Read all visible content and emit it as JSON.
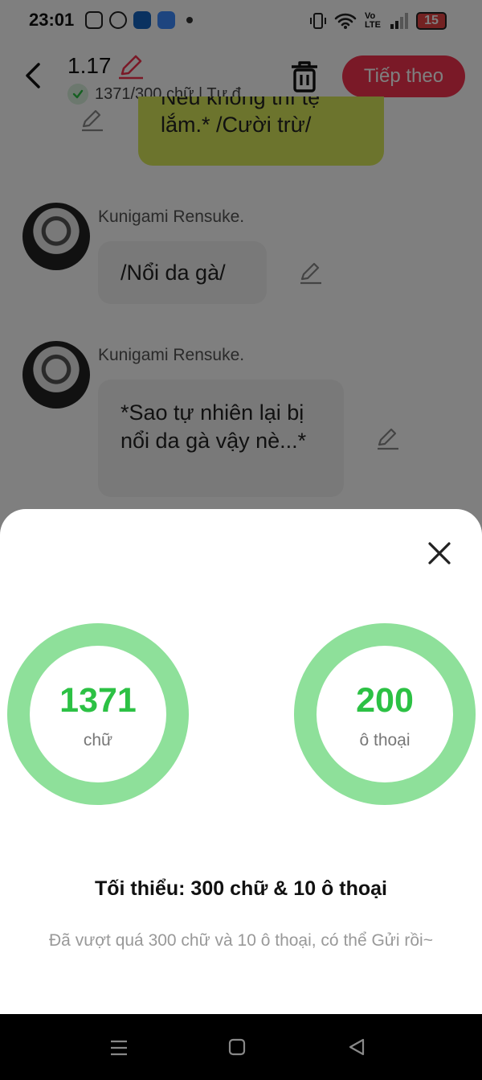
{
  "status_bar": {
    "time": "23:01",
    "network_label": "Vo LTE",
    "battery": "15",
    "app_icons": [
      "instagram-icon",
      "messenger-icon",
      "blue-app-icon",
      "blue-app-2-icon"
    ]
  },
  "header": {
    "title": "1.17",
    "subtitle": "1371/300 chữ | Tự đ",
    "next_label": "Tiếp theo"
  },
  "chat": {
    "partial_bubble_lines": [
      "Nếu không thì tệ",
      "lắm.* /Cười trừ/"
    ],
    "messages": [
      {
        "sender": "Kunigami Rensuke.",
        "text": "/Nổi da gà/"
      },
      {
        "sender": "Kunigami Rensuke.",
        "text": "*Sao tự nhiên lại bị nổi da gà vậy nè...*"
      }
    ]
  },
  "sheet": {
    "word_count": "1371",
    "word_unit": "chữ",
    "dialogue_count": "200",
    "dialogue_unit": "ô thoại",
    "title": "Tối thiểu: 300 chữ & 10 ô thoại",
    "description": "Đã vượt quá 300 chữ và 10 ô thoại, có thể Gửi rồi~"
  },
  "colors": {
    "accent": "#f5334e",
    "ring": "#8ee09a",
    "ring_text": "#2cc144",
    "green_bubble": "#d8e85a"
  }
}
